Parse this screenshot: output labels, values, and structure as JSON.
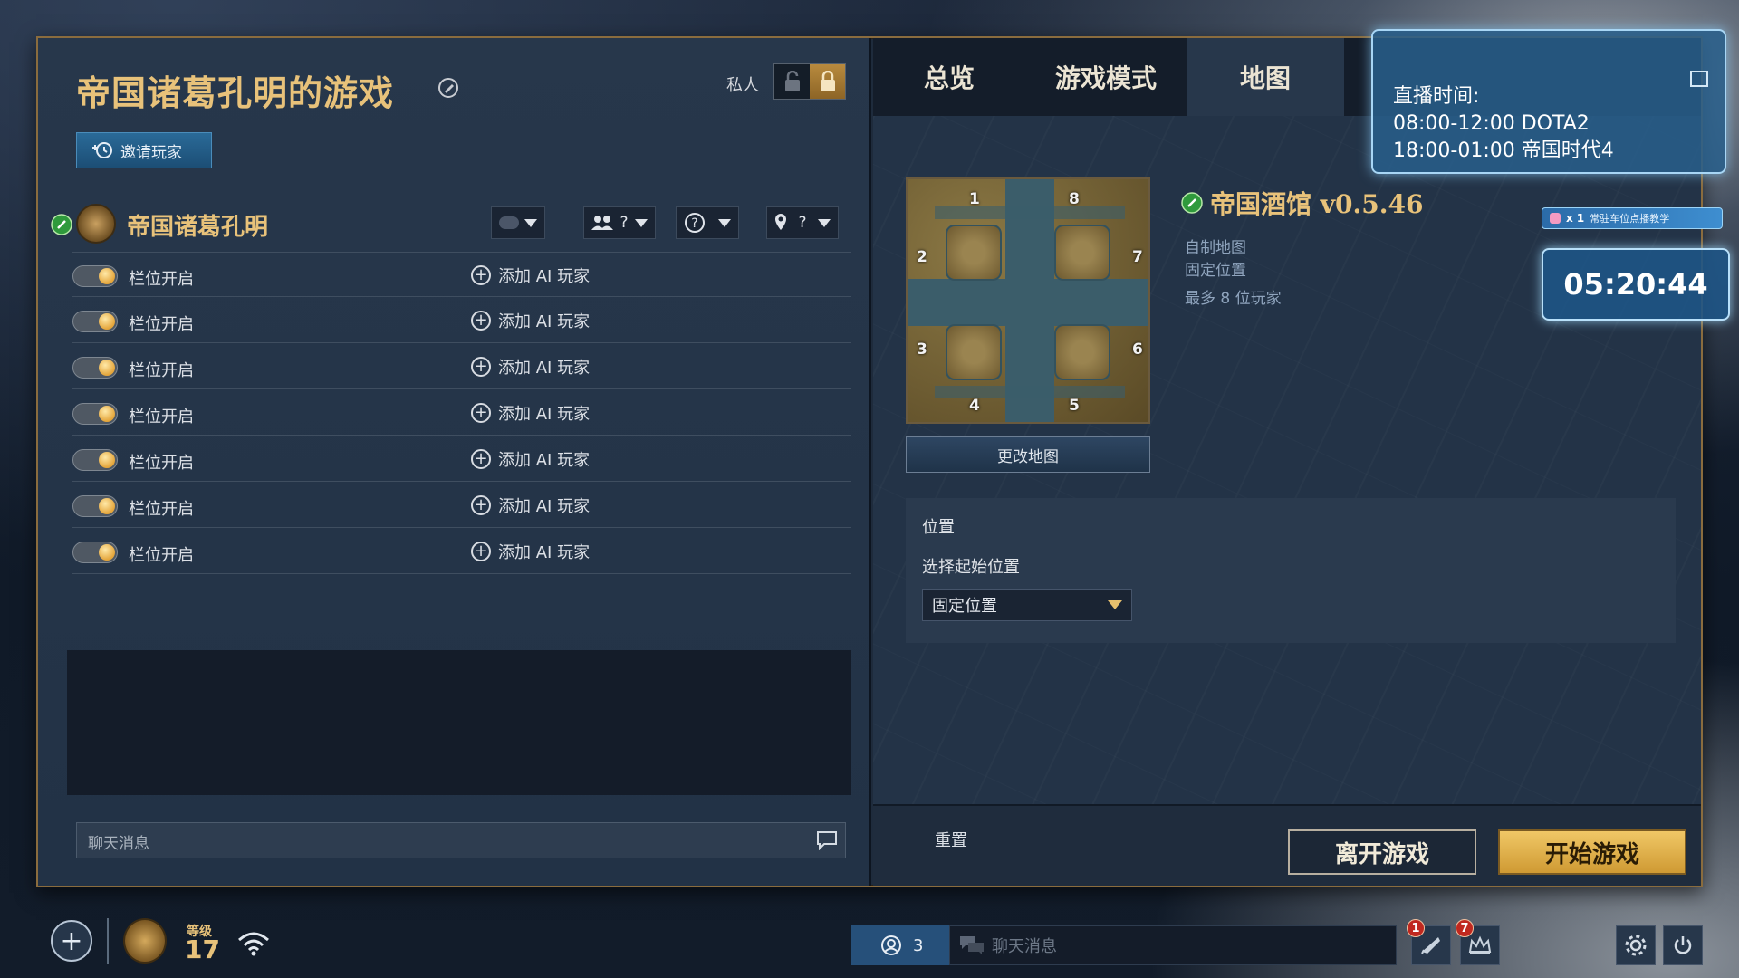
{
  "lobby": {
    "title": "帝国诸葛孔明的游戏",
    "private_label": "私人",
    "invite_label": "邀请玩家",
    "host": {
      "name": "帝国诸葛孔明",
      "team_value": "?",
      "civ_value": "?",
      "pos_value": "?"
    },
    "slots": [
      {
        "label": "栏位开启",
        "add_ai": "添加 AI 玩家"
      },
      {
        "label": "栏位开启",
        "add_ai": "添加 AI 玩家"
      },
      {
        "label": "栏位开启",
        "add_ai": "添加 AI 玩家"
      },
      {
        "label": "栏位开启",
        "add_ai": "添加 AI 玩家"
      },
      {
        "label": "栏位开启",
        "add_ai": "添加 AI 玩家"
      },
      {
        "label": "栏位开启",
        "add_ai": "添加 AI 玩家"
      },
      {
        "label": "栏位开启",
        "add_ai": "添加 AI 玩家"
      }
    ],
    "chat_placeholder": "聊天消息"
  },
  "tabs": [
    {
      "label": "总览"
    },
    {
      "label": "游戏模式"
    },
    {
      "label": "地图",
      "active": true
    }
  ],
  "map": {
    "name": "帝国酒馆 v0.5.46",
    "type": "自制地图",
    "positioning": "固定位置",
    "max_players": "最多 8 位玩家",
    "change_map_label": "更改地图",
    "markers": [
      "1",
      "8",
      "2",
      "7",
      "3",
      "6",
      "4",
      "5"
    ]
  },
  "position": {
    "title": "位置",
    "subtitle": "选择起始位置",
    "selected": "固定位置"
  },
  "footer": {
    "reset_label": "重置",
    "leave_label": "离开游戏",
    "start_label": "开始游戏"
  },
  "stream": {
    "title": "直播时间:",
    "line1": "08:00-12:00 DOTA2",
    "line2": "18:00-01:00 帝国时代4",
    "badge_count": "x 1",
    "badge_text": "常驻车位点播教学",
    "timer": "05:20:44"
  },
  "bottom_bar": {
    "level_label": "等级",
    "level_value": "17",
    "online_count": "3",
    "chat_placeholder": "聊天消息",
    "notif_1": "1",
    "notif_2": "7"
  },
  "colors": {
    "gold": "#e8c27a",
    "panel": "#27374b",
    "accent_blue": "#2a6a98",
    "start_button": "#f0c766"
  }
}
